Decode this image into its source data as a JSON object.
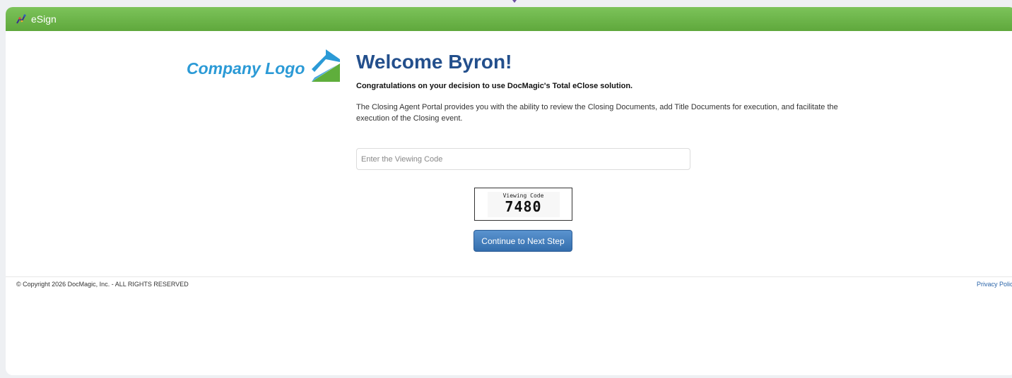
{
  "header": {
    "app_name": "eSign"
  },
  "logo": {
    "text": "Company Logo"
  },
  "main": {
    "welcome": "Welcome Byron!",
    "congrats": "Congratulations on your decision to use DocMagic's Total eClose solution.",
    "description": "The Closing Agent Portal provides you with the ability to review the Closing Documents, add Title Documents for execution, and facilitate the execution of the Closing event.",
    "viewing_code_input": {
      "placeholder": "Enter the Viewing Code",
      "value": ""
    },
    "captcha": {
      "label": "Viewing Code",
      "code": "7480"
    },
    "continue_label": "Continue to Next Step"
  },
  "footer": {
    "copyright": "© Copyright 2026 DocMagic, Inc. - ALL RIGHTS RESERVED",
    "privacy_label": "Privacy Policy"
  },
  "colors": {
    "header_green": "#6bb547",
    "title_blue": "#234f8c",
    "button_blue": "#4680c0",
    "logo_blue": "#2b9ad6"
  }
}
